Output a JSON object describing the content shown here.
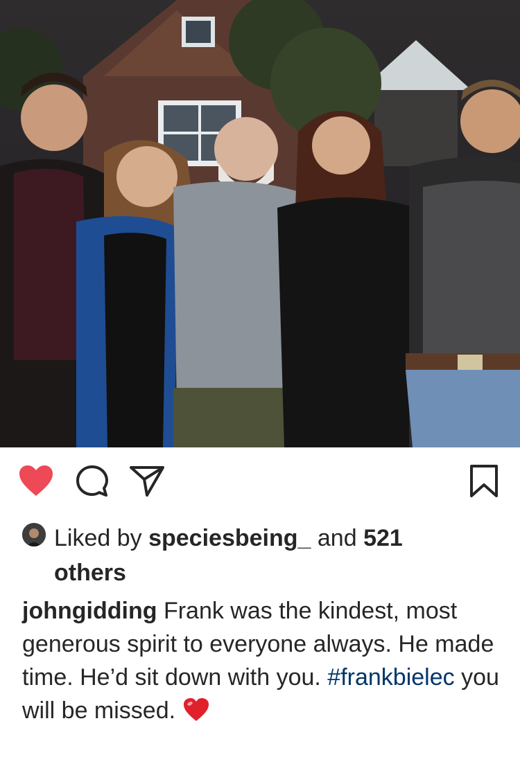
{
  "post": {
    "image_alt": "Group photo of five people standing in front of a brick house",
    "liked_by_prefix": "Liked by",
    "liked_by_user": "speciesbeing_",
    "liked_and": "and",
    "liked_count": "521",
    "liked_others": "others",
    "caption_user": "johngidding",
    "caption_text_1": "Frank was the kindest, most generous spirit to everyone always.  He made time. He’d sit down with you.",
    "caption_hashtag": "#frankbielec",
    "caption_text_2": "you will be missed.",
    "caption_emoji": "red-heart"
  },
  "actions": {
    "like_icon": "heart-filled-icon",
    "comment_icon": "comment-icon",
    "share_icon": "paper-plane-icon",
    "save_icon": "bookmark-icon",
    "like_color": "#ed4956"
  }
}
